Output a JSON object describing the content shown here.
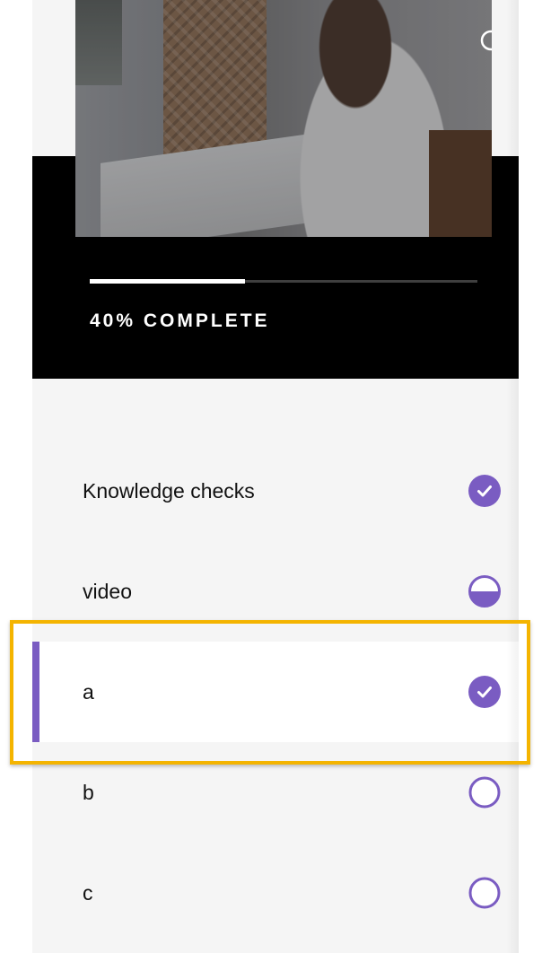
{
  "colors": {
    "accent": "#7a5cc2",
    "header_bg": "#000000",
    "highlight": "#f4b400"
  },
  "header": {
    "search_icon": "search-icon",
    "progress_fraction": 0.4,
    "progress_label": "40% COMPLETE"
  },
  "lessons": [
    {
      "label": "Knowledge checks",
      "status": "complete",
      "icon": "check-circle-icon"
    },
    {
      "label": "video",
      "status": "in-progress",
      "icon": "half-circle-icon"
    },
    {
      "label": "a",
      "status": "complete",
      "icon": "check-circle-icon",
      "active": true
    },
    {
      "label": "b",
      "status": "not-started",
      "icon": "empty-circle-icon"
    },
    {
      "label": "c",
      "status": "not-started",
      "icon": "empty-circle-icon"
    }
  ]
}
